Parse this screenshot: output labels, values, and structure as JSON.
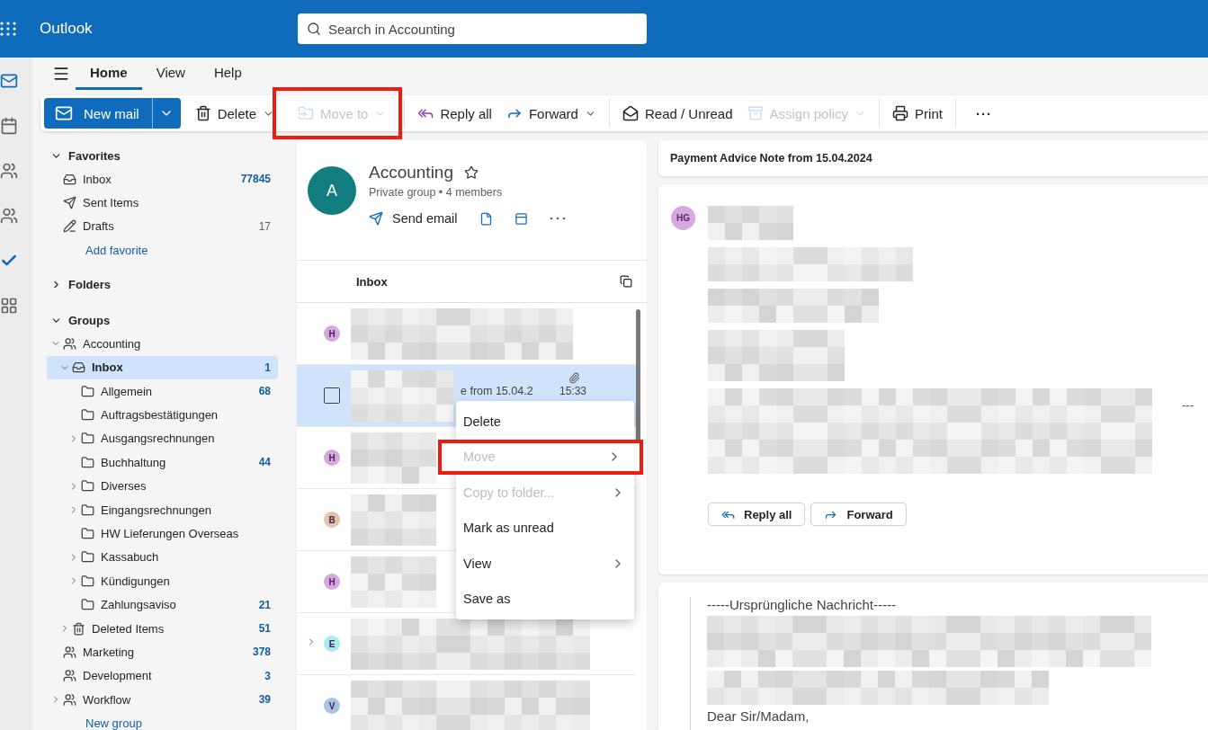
{
  "app": {
    "name": "Outlook",
    "search_placeholder": "Search in Accounting"
  },
  "tabs": [
    {
      "label": "Home",
      "selected": true
    },
    {
      "label": "View",
      "selected": false
    },
    {
      "label": "Help",
      "selected": false
    }
  ],
  "toolbar": [
    {
      "kind": "newmail",
      "label": "New mail",
      "disabled": false,
      "dropdown": true,
      "highlighted": false
    },
    {
      "kind": "delete",
      "label": "Delete",
      "disabled": false,
      "dropdown": true,
      "highlighted": false
    },
    {
      "kind": "move",
      "label": "Move to",
      "disabled": true,
      "dropdown": true,
      "highlighted": true
    },
    {
      "kind": "replyall",
      "label": "Reply all",
      "disabled": false,
      "dropdown": false,
      "highlighted": false
    },
    {
      "kind": "forward",
      "label": "Forward",
      "disabled": false,
      "dropdown": true,
      "highlighted": false
    },
    {
      "kind": "read",
      "label": "Read / Unread",
      "disabled": false,
      "dropdown": false,
      "highlighted": false
    },
    {
      "kind": "policy",
      "label": "Assign policy",
      "disabled": true,
      "dropdown": true,
      "highlighted": false
    },
    {
      "kind": "print",
      "label": "Print",
      "disabled": false,
      "dropdown": false,
      "highlighted": false
    },
    {
      "kind": "more",
      "label": "···",
      "disabled": false,
      "dropdown": false,
      "highlighted": false
    }
  ],
  "nav": {
    "favorites": {
      "title": "Favorites",
      "expanded": true,
      "items": [
        {
          "kind": "inbox",
          "label": "Inbox",
          "count": "77845",
          "unread": true
        },
        {
          "kind": "sent",
          "label": "Sent Items"
        },
        {
          "kind": "drafts",
          "label": "Drafts",
          "count": "17",
          "unread": false
        }
      ],
      "add_link": "Add favorite"
    },
    "folders": {
      "title": "Folders",
      "expanded": false
    },
    "groups": {
      "title": "Groups",
      "expanded": true,
      "items": [
        {
          "kind": "group",
          "label": "Accounting",
          "expanded": true,
          "selected": false,
          "children": [
            {
              "kind": "inbox",
              "label": "Inbox",
              "count": "1",
              "unread": true,
              "expanded": true,
              "selected": true,
              "children": [
                {
                  "kind": "folder",
                  "label": "Allgemein",
                  "count": "68",
                  "unread": true,
                  "selected": false
                },
                {
                  "kind": "folder",
                  "label": "Auftragsbestätigungen",
                  "selected": false
                },
                {
                  "kind": "folder",
                  "label": "Ausgangsrechnungen",
                  "expanded": false,
                  "selected": false
                },
                {
                  "kind": "folder",
                  "label": "Buchhaltung",
                  "count": "44",
                  "unread": true,
                  "selected": false
                },
                {
                  "kind": "folder",
                  "label": "Diverses",
                  "expanded": false,
                  "selected": false
                },
                {
                  "kind": "folder",
                  "label": "Eingangsrechnungen",
                  "expanded": false,
                  "selected": false
                },
                {
                  "kind": "folder",
                  "label": "HW Lieferungen Overseas",
                  "selected": false
                },
                {
                  "kind": "folder",
                  "label": "Kassabuch",
                  "expanded": false,
                  "selected": false
                },
                {
                  "kind": "folder",
                  "label": "Kündigungen",
                  "expanded": false,
                  "selected": false
                },
                {
                  "kind": "folder",
                  "label": "Zahlungsaviso",
                  "count": "21",
                  "unread": true,
                  "selected": false
                }
              ]
            },
            {
              "kind": "trash",
              "label": "Deleted Items",
              "count": "51",
              "unread": true,
              "expanded": false,
              "selected": false
            }
          ]
        },
        {
          "kind": "group",
          "label": "Marketing",
          "count": "378",
          "unread": true,
          "selected": false
        },
        {
          "kind": "group",
          "label": "Development",
          "count": "3",
          "unread": true,
          "selected": false
        },
        {
          "kind": "group",
          "label": "Workflow",
          "count": "39",
          "unread": true,
          "expanded": false,
          "selected": false
        }
      ],
      "add_link": "New group"
    }
  },
  "group_card": {
    "initial": "A",
    "name": "Accounting",
    "type": "Private group",
    "separator": "•",
    "members": "4 members",
    "send": "Send email"
  },
  "list": {
    "title": "Inbox",
    "messages": [
      {
        "initial": "H",
        "color": "#d6a7e0",
        "selected": false
      },
      {
        "selected": true,
        "checked": false,
        "attachment": true,
        "fragment": "e from 15.04.2",
        "time": "15:33"
      },
      {
        "initial": "H",
        "color": "#d6a7e0",
        "selected": false
      },
      {
        "initial": "B",
        "color": "#e3c3ac",
        "selected": false
      },
      {
        "initial": "H",
        "color": "#d6a7e0",
        "selected": false
      },
      {
        "initial": "E",
        "color": "#a9ecee",
        "selected": false,
        "thread": true
      },
      {
        "initial": "V",
        "color": "#a6c5e6",
        "selected": false
      }
    ]
  },
  "context_menu": [
    {
      "label": "Delete",
      "disabled": false,
      "submenu": false,
      "highlighted": false
    },
    {
      "label": "Move",
      "disabled": true,
      "submenu": true,
      "highlighted": true
    },
    {
      "label": "Copy to folder...",
      "disabled": true,
      "submenu": true,
      "highlighted": false
    },
    {
      "label": "Mark as unread",
      "disabled": false,
      "submenu": false,
      "highlighted": false
    },
    {
      "label": "View",
      "disabled": false,
      "submenu": true,
      "highlighted": false
    },
    {
      "label": "Save as",
      "disabled": false,
      "submenu": false,
      "highlighted": false
    }
  ],
  "reading": {
    "subject": "Payment Advice Note from 15.04.2024",
    "sender_initials": "HG",
    "dashes": "---",
    "actions": [
      {
        "kind": "replyall",
        "label": "Reply all"
      },
      {
        "kind": "forward",
        "label": "Forward"
      }
    ],
    "quote_header": "-----Ursprüngliche Nachricht-----",
    "greeting": "Dear Sir/Madam,"
  }
}
